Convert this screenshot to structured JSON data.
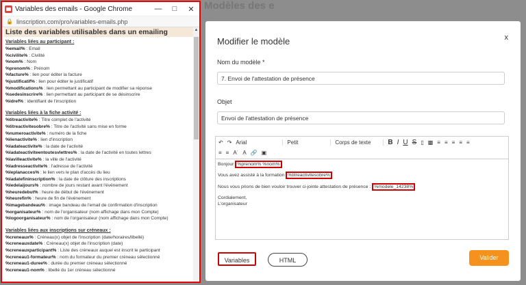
{
  "background": {
    "title": "Modèles des e"
  },
  "popup": {
    "window_title": "Variables des emails - Google Chrome",
    "url": "linscription.com/pro/variables-emails.php",
    "heading": "Liste des variables utilisables dans un emailing",
    "sections": [
      {
        "title": "Variables liées au participant :",
        "items": [
          {
            "var": "%email%",
            "desc": " : Email"
          },
          {
            "var": "%civilite%",
            "desc": " : Civilité"
          },
          {
            "var": "%nom%",
            "desc": " : Nom"
          },
          {
            "var": "%prenom%",
            "desc": " : Prénom"
          },
          {
            "var": "%facture%",
            "desc": " : lien pour éditer la facture"
          },
          {
            "var": "%justificatif%",
            "desc": " : lien pour éditer le justificatif"
          },
          {
            "var": "%modifications%",
            "desc": " : lien permettant au participant de modifier sa réponse"
          },
          {
            "var": "%sedesinscrire%",
            "desc": " : lien permettant au participant de se désinscrire"
          },
          {
            "var": "%idref%",
            "desc": " : identifiant de l'inscription"
          }
        ]
      },
      {
        "title": "Variables liées à la fiche activité :",
        "items": [
          {
            "var": "%titreactivite%",
            "desc": " : Titre complet de l'activité"
          },
          {
            "var": "%titreactivitesobre%",
            "desc": " : Titre de l'activité sans mise en forme"
          },
          {
            "var": "%numeroactivite%",
            "desc": " : numéro de la fiche"
          },
          {
            "var": "%lienactivite%",
            "desc": " : lien d'inscription"
          },
          {
            "var": "%ladateactivite%",
            "desc": " : la date de l'activité"
          },
          {
            "var": "%ladateactiviteentoutesvlettres%",
            "desc": " : la date de l'activité en toutes lettres"
          },
          {
            "var": "%lavilleactivite%",
            "desc": " : la ville de l'activité"
          },
          {
            "var": "%ladresseactivite%",
            "desc": " : l'adresse de l'activité"
          },
          {
            "var": "%leplanacces%",
            "desc": " : le lien vers le plan d'accès du lieu"
          },
          {
            "var": "%ladatefininscription%",
            "desc": " : la date de clôture des inscriptions"
          },
          {
            "var": "%ledelaijours%",
            "desc": " : nombre de jours restant avant l'événement"
          },
          {
            "var": "%heuredebut%",
            "desc": " : heure de début de l'événement"
          },
          {
            "var": "%heurefin%",
            "desc": " : heure de fin de l'événement"
          },
          {
            "var": "%imagebandeau%",
            "desc": " : image bandeau de l'email de confirmation d'inscription"
          },
          {
            "var": "%organisateur%",
            "desc": " : nom de l'organisateur (nom affichage dans mon Compte)"
          },
          {
            "var": "%logoorganisateur%",
            "desc": " : nom de l'organisateur (nom affichage dans mon Compte)"
          }
        ]
      },
      {
        "title": "Variables liées aux inscriptions sur créneaux :",
        "items": [
          {
            "var": "%creneaux%",
            "desc": " : Créneau(x) objet de l'inscription (date/horaires/libellé)"
          },
          {
            "var": "%creneauxdate%",
            "desc": " : Créneau(x) objet de l'inscription (date)"
          },
          {
            "var": "%creneauxparticipant%",
            "desc": " : Liste des créneaux auquel est inscrit le participant"
          },
          {
            "var": "%creneau1-formateur%",
            "desc": " : nom du formateur du premier créneau sélectionné"
          },
          {
            "var": "%creneau1-duree%",
            "desc": " : durée du premier créneau sélectionné"
          },
          {
            "var": "%creneau1-nom%",
            "desc": " : libellé du 1er créneau sélectionné"
          }
        ]
      }
    ]
  },
  "modal": {
    "title": "Modifier le modèle",
    "close": "x",
    "name_label": "Nom du modèle *",
    "name_value": "7. Envoi de l'attestation de présence",
    "subject_label": "Objet",
    "subject_value": "Envoi de l'attestation de présence",
    "toolbar": {
      "font": "Arial",
      "size": "Petit",
      "style": "Corps de texte"
    },
    "editor": {
      "l1_pre": "Bonjour ",
      "l1_var": "%prenom% %nom%",
      "l2_pre": "Vous avez assisté à la formation ",
      "l2_var": "%titreactivitesobre%",
      "l3_pre": "Nous vous prions de bien vouloir trouver ci-jointe attestation de présence : ",
      "l3_var": "%modele_14238%",
      "l4": "Cordialement,",
      "l5": "L'organisateur"
    },
    "buttons": {
      "variables": "Variables",
      "html": "HTML",
      "validate": "Valider"
    },
    "colors": {
      "accent": "#f5921e",
      "highlight": "#cc0000"
    }
  }
}
